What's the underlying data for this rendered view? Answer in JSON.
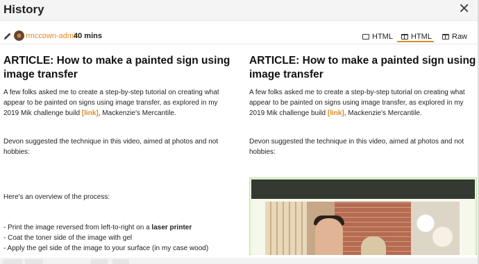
{
  "modal": {
    "title": "History",
    "close_icon": "close-icon"
  },
  "revision": {
    "edit_icon": "pencil-icon",
    "author": "rmccown-admin",
    "age": "40 mins"
  },
  "view_modes": {
    "inline_html": "HTML",
    "side_by_side_html": "HTML",
    "raw": "Raw",
    "active": "side_by_side_html"
  },
  "left_pane": {
    "title": "ARTICLE: How to make a painted sign using image transfer",
    "p1_text": "A few folks asked me to create a step-by-step tutorial on creating what appear to be painted on signs using image transfer, as explored in my 2019 Mik challenge build ",
    "p1_link": "[link]",
    "p1_tail": ", Mackenzie's Mercantile.",
    "p2": "Devon suggested the technique in this video, aimed at photos and not hobbies:",
    "p3": "Here's an overview of the process:",
    "list": {
      "item1_text": "- Print the image reversed from left-to-right on a ",
      "item1_bold": "laser printer",
      "item2": "- Coat the toner side of the image with gel",
      "item3": "- Apply the gel side of the image to your surface (in my case wood)"
    }
  },
  "right_pane": {
    "title": "ARTICLE: How to make a painted sign using image transfer",
    "p1_text": "A few folks asked me to create a step-by-step tutorial on creating what appear to be painted on signs using image transfer, as explored in my 2019 Mik challenge build ",
    "p1_link": "[link]",
    "p1_tail": ", Mackenzie's Mercantile.",
    "p2": "Devon suggested the technique in this video, aimed at photos and not hobbies:"
  },
  "colors": {
    "accent": "#e08a1e",
    "insertion_bg": "#e6f5d8",
    "video_bar": "#343a31"
  }
}
